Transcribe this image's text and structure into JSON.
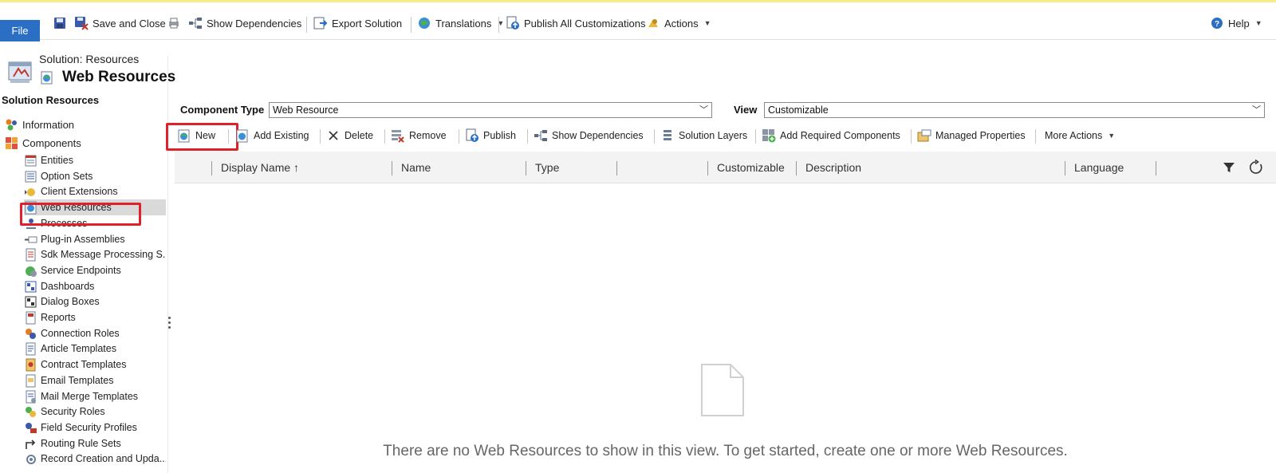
{
  "toolbar": {
    "file_label": "File",
    "save_close_label": "Save and Close",
    "show_dependencies_label": "Show Dependencies",
    "export_solution_label": "Export Solution",
    "translations_label": "Translations",
    "publish_all_label": "Publish All Customizations",
    "actions_label": "Actions",
    "help_label": "Help"
  },
  "header": {
    "caption": "Solution: Resources",
    "title": "Web Resources"
  },
  "sidebar": {
    "heading": "Solution Resources",
    "top_items": [
      {
        "label": "Information",
        "icon": "information-icon"
      },
      {
        "label": "Components",
        "icon": "components-icon"
      }
    ],
    "items": [
      {
        "label": "Entities",
        "icon": "entities-icon"
      },
      {
        "label": "Option Sets",
        "icon": "option-sets-icon"
      },
      {
        "label": "Client Extensions",
        "icon": "client-extensions-icon"
      },
      {
        "label": "Web Resources",
        "icon": "web-resources-icon",
        "selected": true
      },
      {
        "label": "Processes",
        "icon": "processes-icon"
      },
      {
        "label": "Plug-in Assemblies",
        "icon": "plugin-assemblies-icon"
      },
      {
        "label": "Sdk Message Processing S...",
        "icon": "sdk-message-icon"
      },
      {
        "label": "Service Endpoints",
        "icon": "service-endpoints-icon"
      },
      {
        "label": "Dashboards",
        "icon": "dashboards-icon"
      },
      {
        "label": "Dialog Boxes",
        "icon": "dialog-boxes-icon"
      },
      {
        "label": "Reports",
        "icon": "reports-icon"
      },
      {
        "label": "Connection Roles",
        "icon": "connection-roles-icon"
      },
      {
        "label": "Article Templates",
        "icon": "article-templates-icon"
      },
      {
        "label": "Contract Templates",
        "icon": "contract-templates-icon"
      },
      {
        "label": "Email Templates",
        "icon": "email-templates-icon"
      },
      {
        "label": "Mail Merge Templates",
        "icon": "mail-merge-templates-icon"
      },
      {
        "label": "Security Roles",
        "icon": "security-roles-icon"
      },
      {
        "label": "Field Security Profiles",
        "icon": "field-security-icon"
      },
      {
        "label": "Routing Rule Sets",
        "icon": "routing-rule-icon"
      },
      {
        "label": "Record Creation and Upda...",
        "icon": "record-creation-icon"
      }
    ]
  },
  "filters": {
    "component_type_label": "Component Type",
    "component_type_value": "Web Resource",
    "view_label": "View",
    "view_value": "Customizable"
  },
  "actions": {
    "new": "New",
    "add_existing": "Add Existing",
    "delete": "Delete",
    "remove": "Remove",
    "publish": "Publish",
    "show_dependencies": "Show Dependencies",
    "solution_layers": "Solution Layers",
    "add_required": "Add Required Components",
    "managed_properties": "Managed Properties",
    "more_actions": "More Actions"
  },
  "grid": {
    "columns": [
      "Display Name ↑",
      "Name",
      "Type",
      "",
      "Customizable",
      "Description",
      "Language"
    ],
    "empty_message": "There are no Web Resources to show in this view. To get started, create one or more Web Resources."
  },
  "colors": {
    "accent": "#2b6fc4",
    "highlight": "#e0202a"
  }
}
